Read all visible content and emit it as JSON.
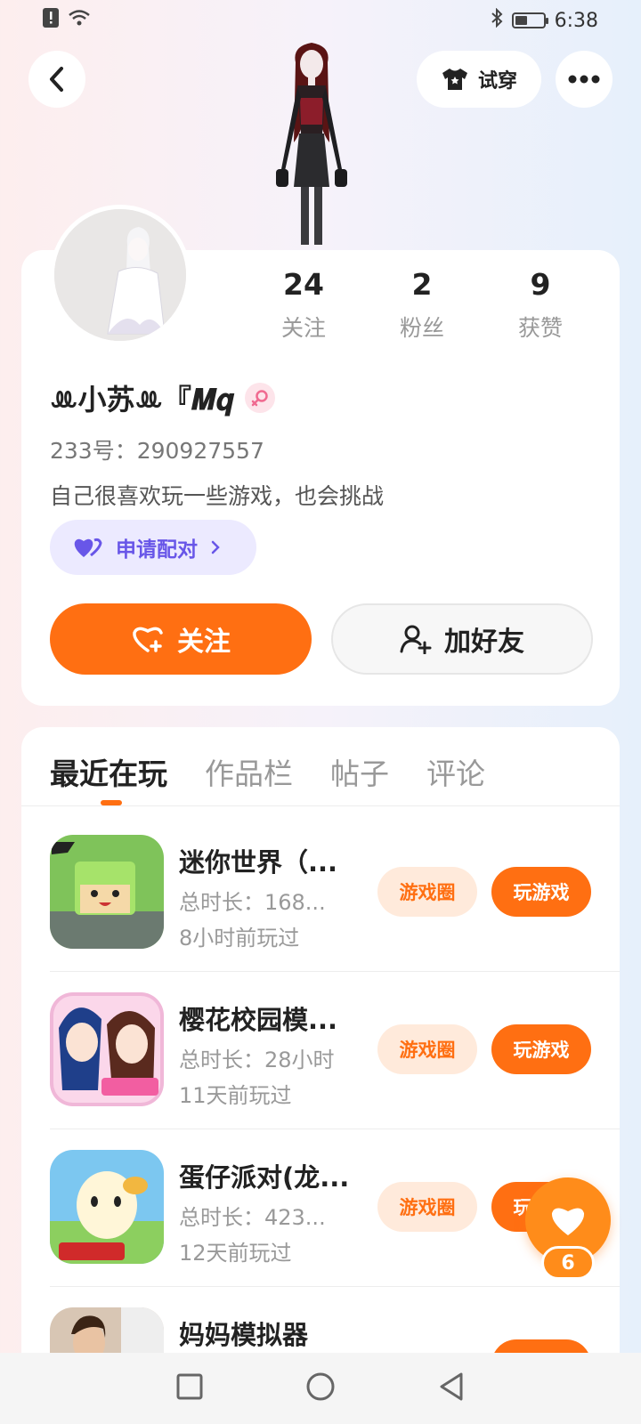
{
  "status_bar": {
    "time": "6:38"
  },
  "header": {
    "tryon_label": "试穿"
  },
  "profile": {
    "stats": [
      {
        "value": "24",
        "label": "关注"
      },
      {
        "value": "2",
        "label": "粉丝"
      },
      {
        "value": "9",
        "label": "获赞"
      }
    ],
    "username": "ꔛ小苏ꔛ『𝑴𝒒",
    "uid": "233号：290927557",
    "bio": "自己很喜欢玩一些游戏，也会挑战",
    "pair_label": "申请配对",
    "follow_label": "关注",
    "add_friend_label": "加好友"
  },
  "tabs": [
    {
      "label": "最近在玩",
      "active": true
    },
    {
      "label": "作品栏",
      "active": false
    },
    {
      "label": "帖子",
      "active": false
    },
    {
      "label": "评论",
      "active": false
    }
  ],
  "games": [
    {
      "name": "迷你世界（...",
      "time": "总时长：168...",
      "last": "8小时前玩过",
      "circle_label": "游戏圈",
      "play_label": "玩游戏"
    },
    {
      "name": "樱花校园模...",
      "time": "总时长：28小时",
      "last": "11天前玩过",
      "circle_label": "游戏圈",
      "play_label": "玩游戏"
    },
    {
      "name": "蛋仔派对(龙...",
      "time": "总时长：423...",
      "last": "12天前玩过",
      "circle_label": "游戏圈",
      "play_label": "玩游戏"
    },
    {
      "name": "妈妈模拟器",
      "time": "",
      "last": "",
      "circle_label": "",
      "play_label": ""
    }
  ],
  "like_count": "6",
  "colors": {
    "accent": "#ff6f12",
    "pair": "#6856e8"
  }
}
